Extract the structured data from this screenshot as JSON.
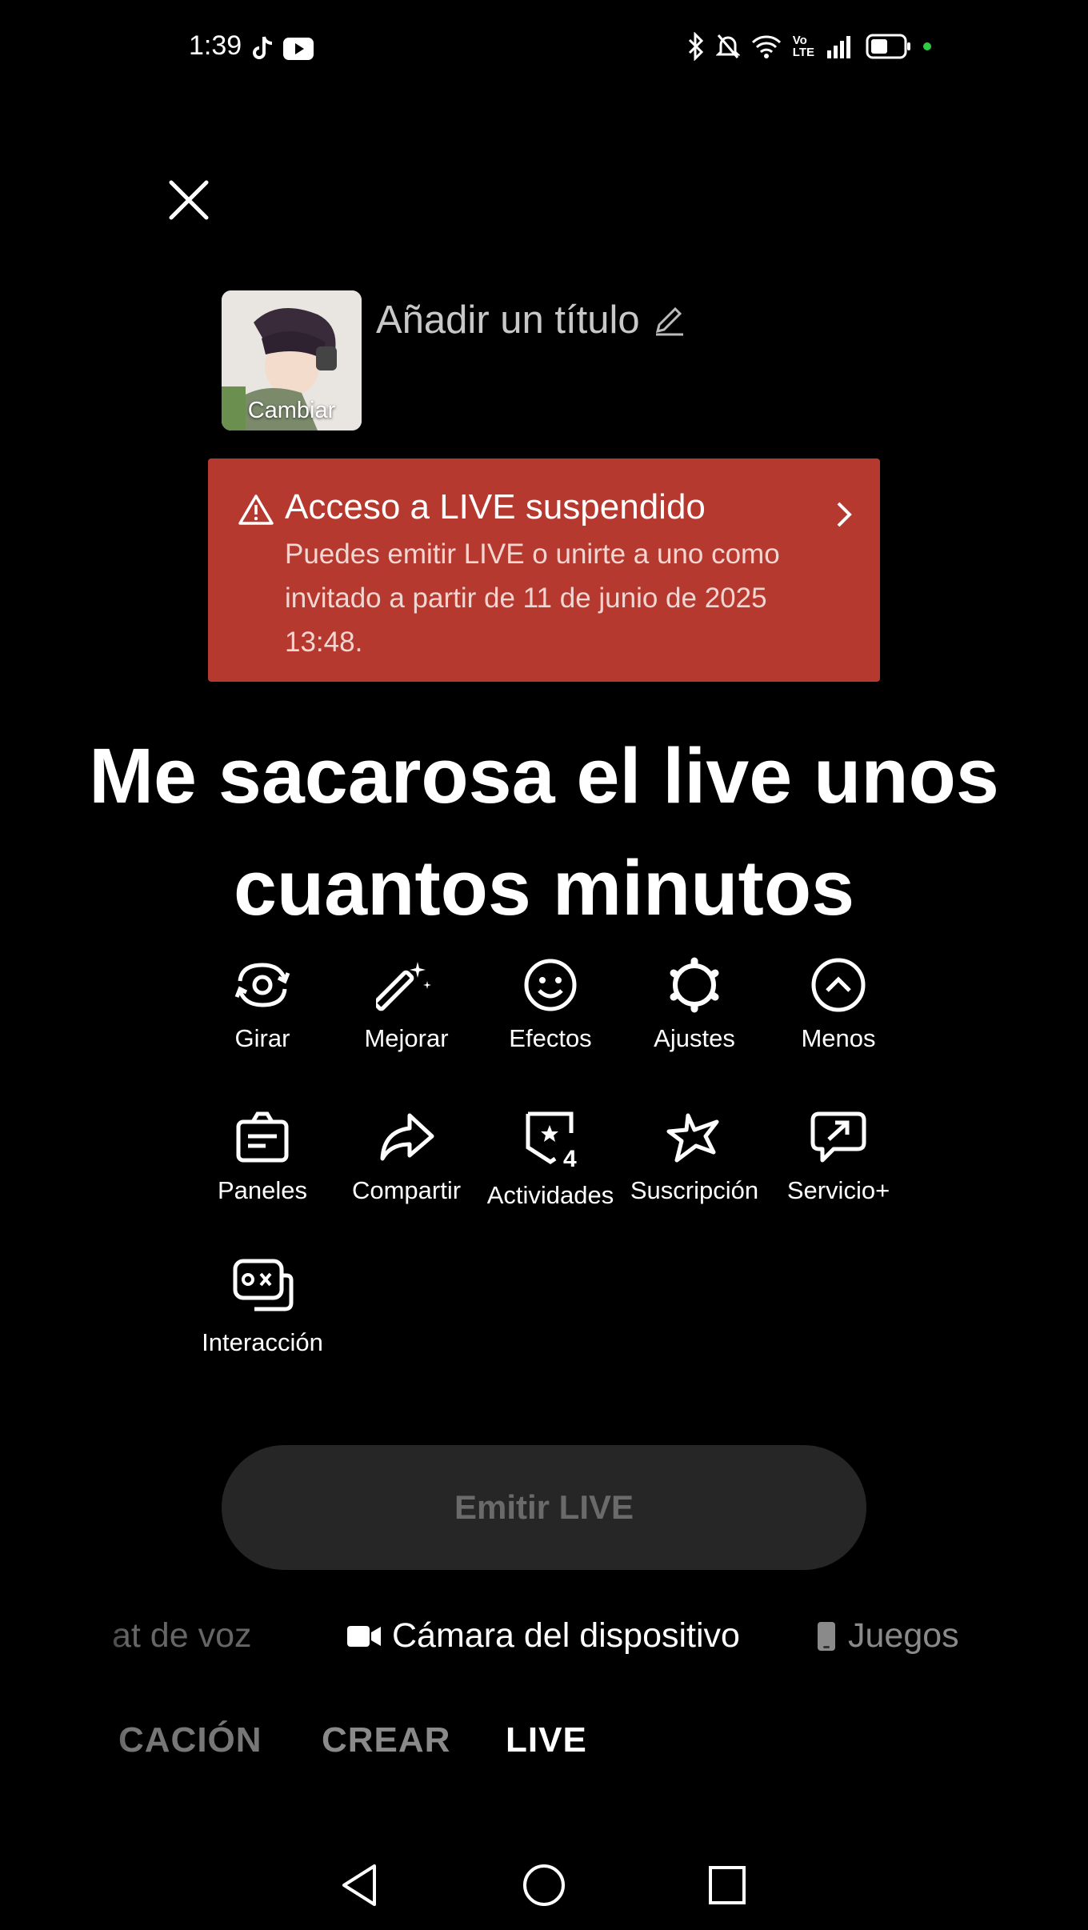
{
  "status_bar": {
    "time": "1:39",
    "app_icons": [
      "tiktok-icon",
      "youtube-icon"
    ],
    "right_icons": [
      "bluetooth-icon",
      "mute-icon",
      "wifi-icon",
      "volte-icon",
      "signal-icon",
      "battery-icon"
    ],
    "volte_top": "Vo",
    "volte_bottom": "LTE",
    "indicator_color": "#2ecc40"
  },
  "header": {
    "close_icon": "close-icon",
    "avatar_label": "Cambiar",
    "title_placeholder": "Añadir un título"
  },
  "banner": {
    "title": "Acceso a LIVE suspendido",
    "body": "Puedes emitir LIVE o unirte a uno como invitado a partir de 11 de junio de 2025 13:48.",
    "color": "#b5392e"
  },
  "headline": {
    "line1": "Me sacarosa el live unos",
    "line2": "cuantos minutos"
  },
  "tools": [
    {
      "label": "Girar",
      "icon": "rotate-camera-icon"
    },
    {
      "label": "Mejorar",
      "icon": "magic-wand-icon"
    },
    {
      "label": "Efectos",
      "icon": "smiley-icon"
    },
    {
      "label": "Ajustes",
      "icon": "gear-icon"
    },
    {
      "label": "Menos",
      "icon": "chevron-up-circle-icon"
    },
    {
      "label": "Paneles",
      "icon": "panels-icon"
    },
    {
      "label": "Compartir",
      "icon": "share-icon"
    },
    {
      "label": "Actividades",
      "icon": "activities-icon",
      "badge": "4"
    },
    {
      "label": "Suscripción",
      "icon": "subscription-star-icon"
    },
    {
      "label": "Servicio+",
      "icon": "service-plus-icon"
    },
    {
      "label": "Interacción",
      "icon": "interaction-icon"
    }
  ],
  "primary_button": {
    "label": "Emitir LIVE"
  },
  "modes": [
    {
      "label": "at de voz"
    },
    {
      "label": "Cámara del dispositivo",
      "icon": "video-camera-icon"
    },
    {
      "label": "Juegos",
      "icon": "phone-icon"
    }
  ],
  "bottom_nav": [
    {
      "label": "CACIÓN"
    },
    {
      "label": "CREAR"
    },
    {
      "label": "LIVE"
    }
  ],
  "system_nav": [
    "back-icon",
    "home-icon",
    "recents-icon"
  ]
}
